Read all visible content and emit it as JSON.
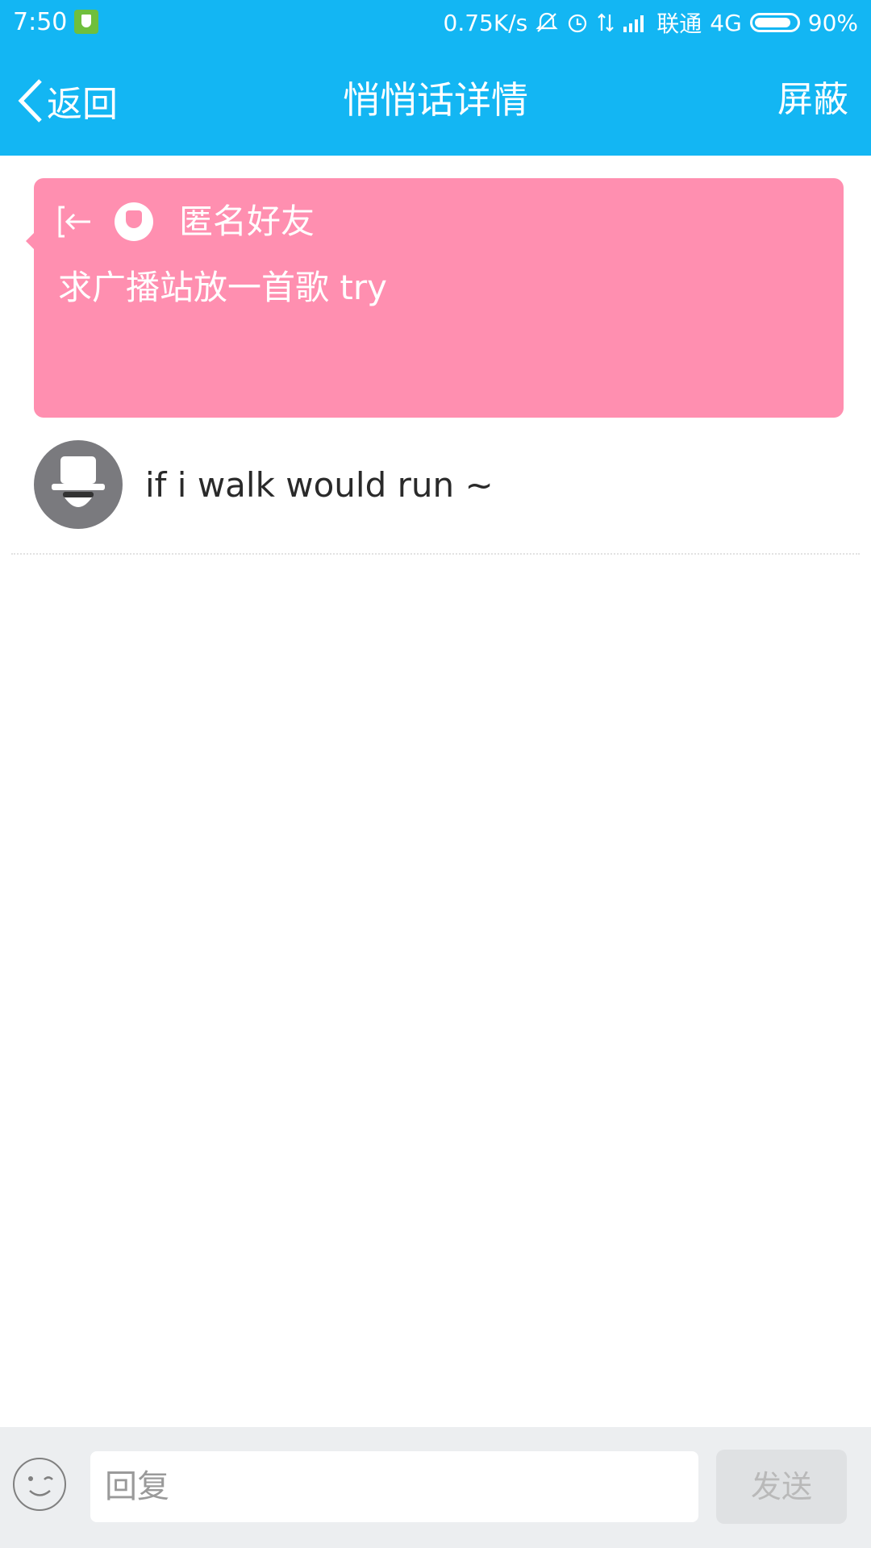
{
  "status_bar": {
    "time": "7:50",
    "net_speed": "0.75K/s",
    "carrier": "联通",
    "network": "4G",
    "battery": "90%",
    "battery_level": 0.9
  },
  "nav": {
    "back_label": "返回",
    "title": "悄悄话详情",
    "block_label": "屏蔽"
  },
  "message": {
    "sender": "匿名好友",
    "text": "求广播站放一首歌 try"
  },
  "reply": {
    "text": "if i walk would run ~"
  },
  "input_bar": {
    "placeholder": "回复",
    "send_label": "发送"
  },
  "colors": {
    "header": "#13b6f3",
    "card": "#ff8fb0",
    "avatar": "#7a7a7e",
    "input_bar": "#eceef0"
  }
}
